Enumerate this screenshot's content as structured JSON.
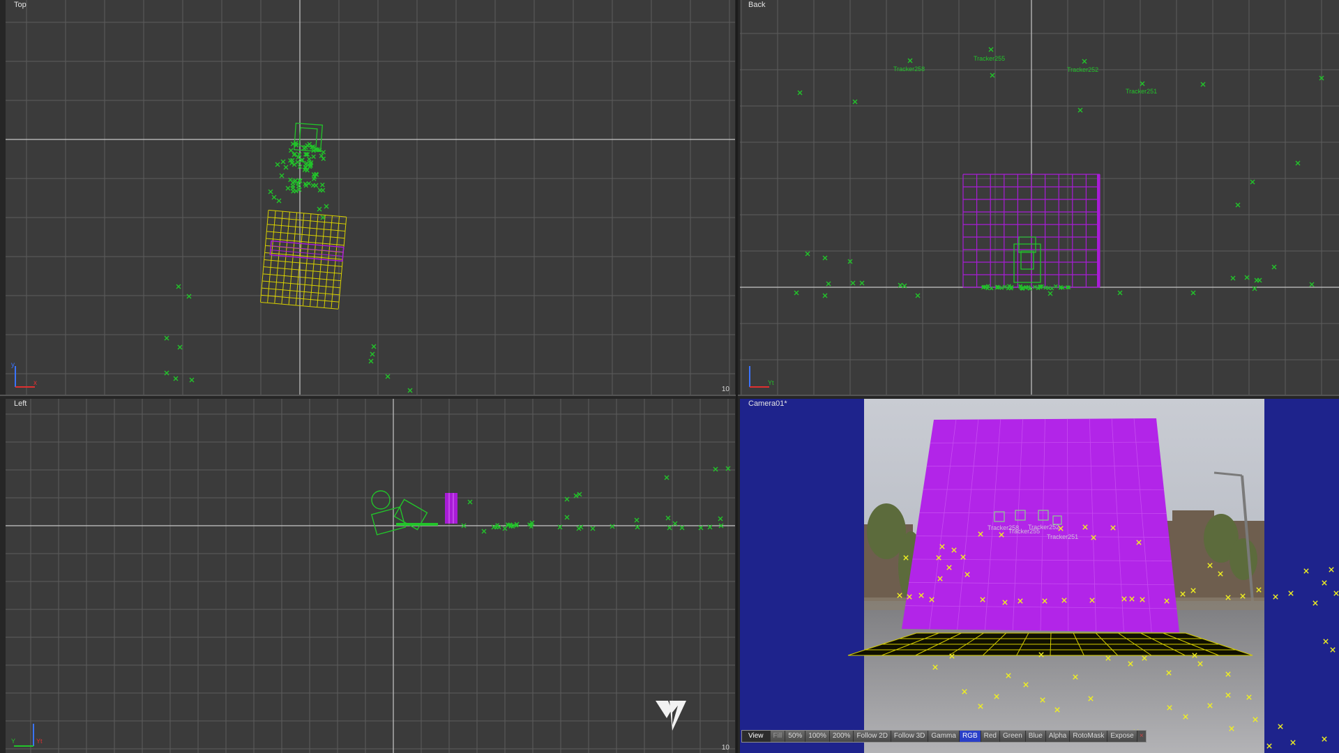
{
  "viewports": {
    "top": {
      "label": "Top",
      "scale": "10"
    },
    "back": {
      "label": "Back",
      "trackers": [
        "Tracker258",
        "Tracker255",
        "Tracker252",
        "Tracker251"
      ]
    },
    "left": {
      "label": "Left",
      "scale": "10"
    },
    "camera": {
      "label": "Camera01*",
      "trackers": [
        "Tracker258",
        "Tracker255",
        "Tracker252",
        "Tracker251"
      ]
    }
  },
  "toolbar": {
    "view": "View",
    "buttons": [
      "Fill",
      "50%",
      "100%",
      "200%",
      "Follow 2D",
      "Follow 3D",
      "Gamma",
      "RGB",
      "Red",
      "Green",
      "Blue",
      "Alpha",
      "RotoMask",
      "Expose"
    ],
    "active": "RGB",
    "close": "×"
  },
  "colors": {
    "viewport_bg": "#3b3b3b",
    "grid": "#5c5c5c",
    "axis": "#c8c8c8",
    "tracker_green": "#22c42a",
    "plane_magenta": "#a81cd6",
    "plane_fill": "#b225e8",
    "ground_yellow": "#d8d000",
    "camera_matte": "#1e238c",
    "tracker_yellow": "#f0f020"
  },
  "icons": [
    "axis-gizmo-icon",
    "tracker-x-icon",
    "brand-logo-icon"
  ]
}
